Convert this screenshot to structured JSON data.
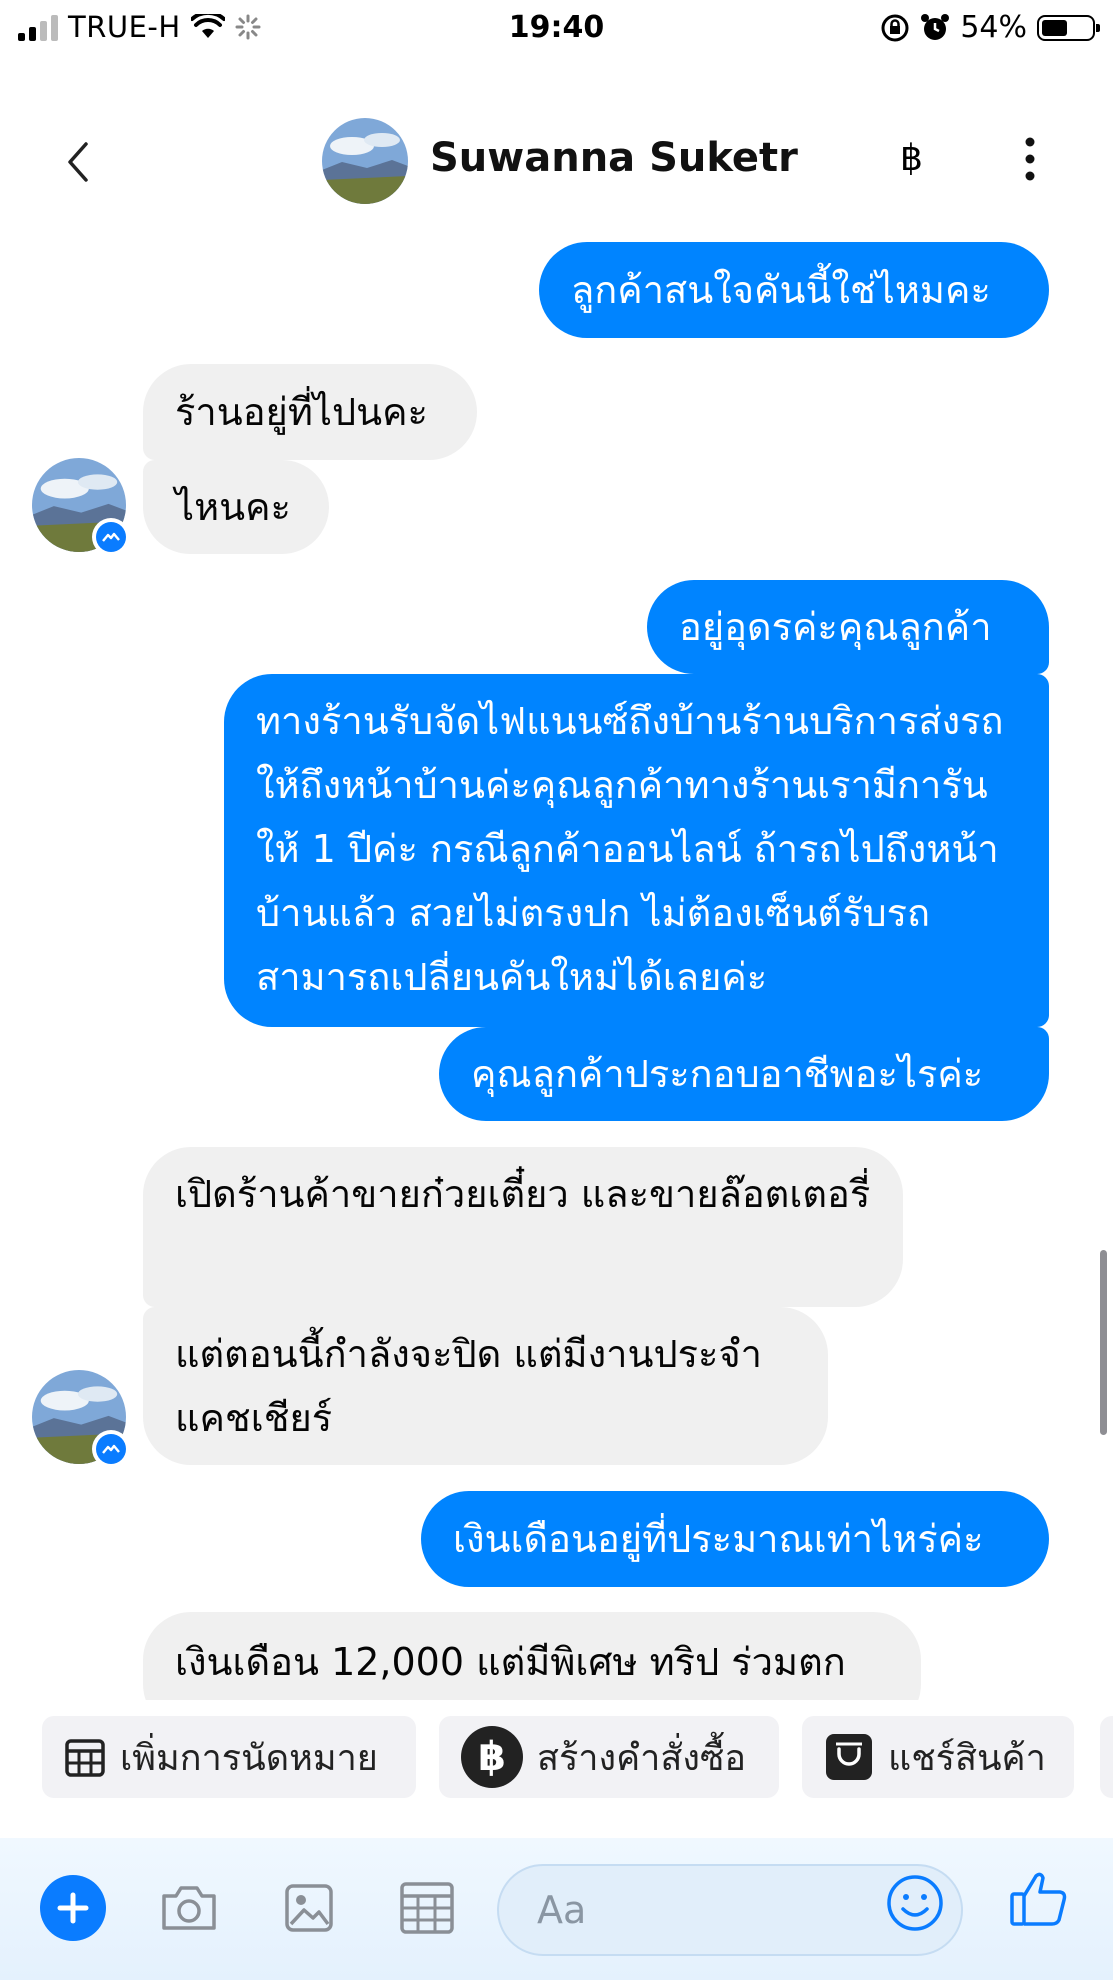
{
  "status_bar": {
    "carrier": "TRUE-H",
    "time": "19:40",
    "battery": "54%",
    "battery_level": 0.54
  },
  "header": {
    "contact_name": "Suwanna Suketr",
    "currency_icon": "฿"
  },
  "messages": [
    {
      "side": "out",
      "text": "ลูกค้าสนใจคันนี้ใช่ไหมคะ"
    },
    {
      "side": "in",
      "text": "ร้านอยู่ที่ไปนคะ"
    },
    {
      "side": "in",
      "text": "ไหนคะ"
    },
    {
      "side": "out",
      "text": "อยู่อุดรค่ะคุณลูกค้า"
    },
    {
      "side": "out",
      "text": "ทางร้านรับจัดไฟแนนซ์ถึงบ้านร้านบริการส่งรถให้ถึงหน้าบ้านค่ะคุณลูกค้าทางร้านเรามีการันให้ 1 ปีค่ะ กรณีลูกค้าออนไลน์ ถ้ารถไปถึงหน้าบ้านแล้ว สวยไม่ตรงปก ไม่ต้องเซ็นต์รับรถ สามารถเปลี่ยนคันใหม่ได้เลยค่ะ"
    },
    {
      "side": "out",
      "text": "คุณลูกค้าประกอบอาชีพอะไรค่ะ"
    },
    {
      "side": "in",
      "text": "เปิดร้านค้าขายก๋วยเตี๋ยว และขายล๊อตเตอรี่"
    },
    {
      "side": "in",
      "text": "แต่ตอนนี้กำลังจะปิด แต่มีงานประจำแคชเชียร์"
    },
    {
      "side": "out",
      "text": "เงินเดือนอยู่ที่ประมาณเท่าไหร่ค่ะ"
    },
    {
      "side": "in",
      "text": "เงินเดือน 12,000 แต่มีพิเศษ ทริป ร่วมตก"
    }
  ],
  "quick_actions": [
    {
      "label": "เพิ่มการนัดหมาย",
      "icon": "calendar-icon"
    },
    {
      "label": "สร้างคำสั่งซื้อ",
      "icon": "baht-circle-icon"
    },
    {
      "label": "แชร์สินค้า",
      "icon": "shopping-bag-icon"
    }
  ],
  "composer": {
    "placeholder": "Aa"
  },
  "colors": {
    "outgoing_bubble": "#0084ff",
    "incoming_bubble": "#f0f0f0",
    "accent": "#0a7cff"
  }
}
